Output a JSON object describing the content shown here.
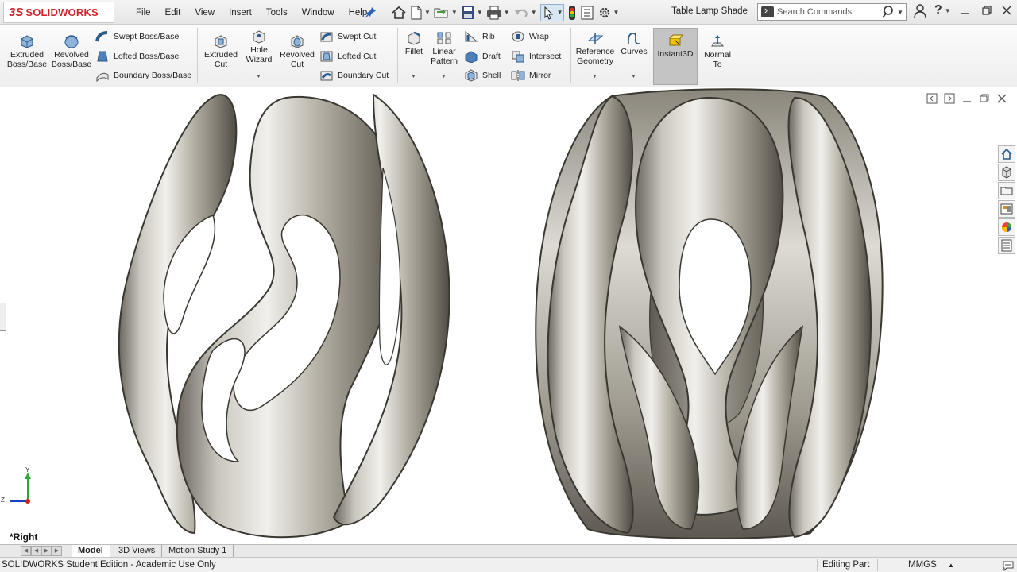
{
  "app": {
    "logo_prefix": "3S",
    "logo_text": "SOLIDWORKS",
    "document_title": "Table Lamp Shade"
  },
  "menu": [
    "File",
    "Edit",
    "View",
    "Insert",
    "Tools",
    "Window",
    "Help"
  ],
  "search": {
    "placeholder": "Search Commands"
  },
  "ribbon": {
    "extruded_boss": "Extruded Boss/Base",
    "revolved_boss": "Revolved Boss/Base",
    "swept_boss": "Swept Boss/Base",
    "lofted_boss": "Lofted Boss/Base",
    "boundary_boss": "Boundary Boss/Base",
    "extruded_cut": "Extruded Cut",
    "hole_wizard": "Hole Wizard",
    "revolved_cut": "Revolved Cut",
    "swept_cut": "Swept Cut",
    "lofted_cut": "Lofted Cut",
    "boundary_cut": "Boundary Cut",
    "fillet": "Fillet",
    "linear_pattern": "Linear Pattern",
    "rib": "Rib",
    "draft": "Draft",
    "shell": "Shell",
    "wrap": "Wrap",
    "intersect": "Intersect",
    "mirror": "Mirror",
    "reference_geometry": "Reference Geometry",
    "curves": "Curves",
    "instant3d": "Instant3D",
    "normal_to": "Normal To"
  },
  "viewport": {
    "view_name": "*Right",
    "triad": {
      "y_label": "Y",
      "z_label": "Z"
    }
  },
  "tabs": [
    "Model",
    "3D Views",
    "Motion Study 1"
  ],
  "status": {
    "edition": "SOLIDWORKS Student Edition - Academic Use Only",
    "mode": "Editing Part",
    "units": "MMGS"
  },
  "colors": {
    "brand": "#d2232a",
    "surface_light": "#ecebe6",
    "surface_dark": "#6f6b62",
    "viewport_bg": "#ffffff"
  }
}
